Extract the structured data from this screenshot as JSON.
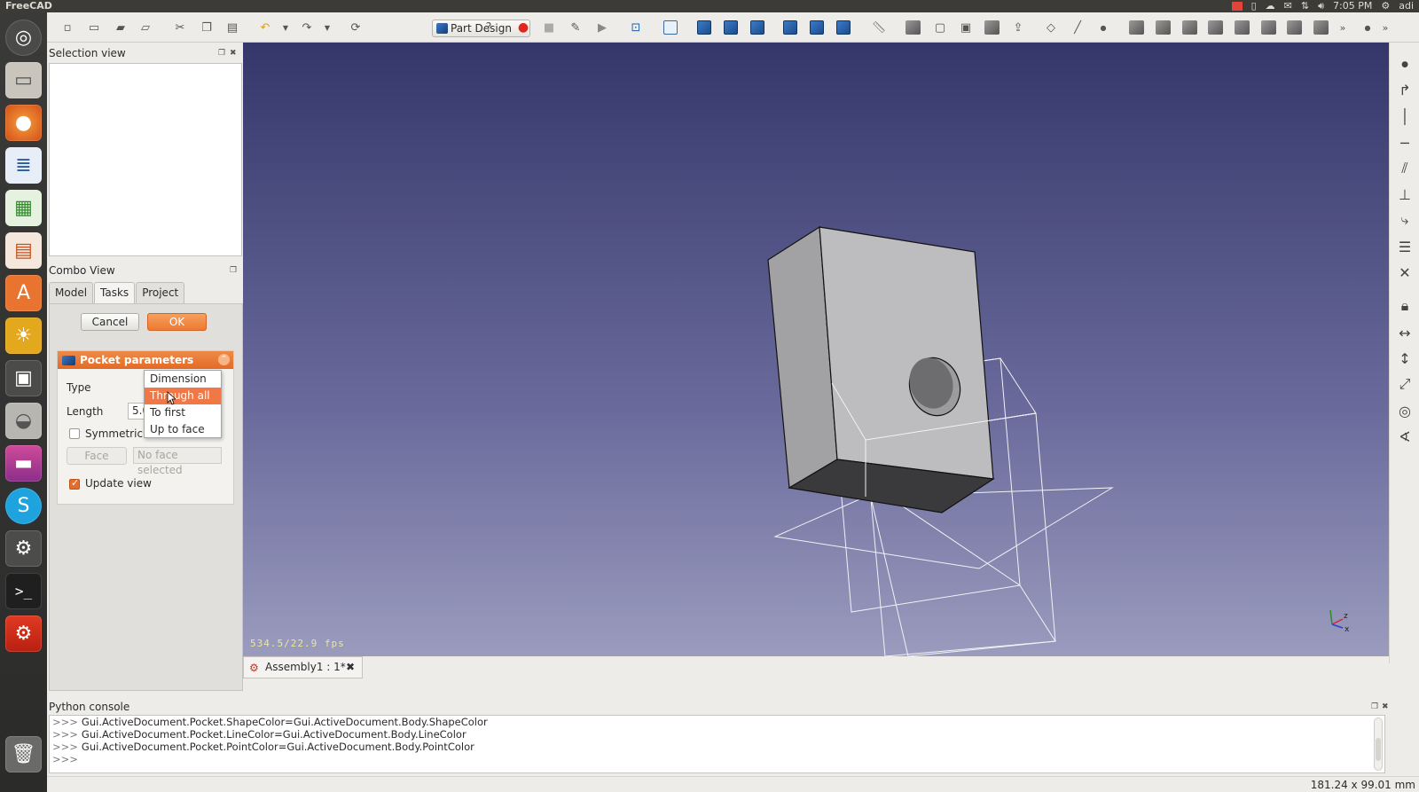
{
  "topbar": {
    "app_title": "FreeCAD",
    "time": "7:05 PM",
    "user": "adi"
  },
  "toolbar": {
    "workbench": "Part Design"
  },
  "selection_view": {
    "title": "Selection view"
  },
  "combo_view": {
    "title": "Combo View",
    "tabs": [
      {
        "label": "Model"
      },
      {
        "label": "Tasks"
      },
      {
        "label": "Project"
      }
    ],
    "cancel_label": "Cancel",
    "ok_label": "OK",
    "pocket": {
      "title": "Pocket parameters",
      "type_label": "Type",
      "length_label": "Length",
      "length_value": "5.0",
      "symmetric_label": "Symmetric to",
      "face_button": "Face",
      "face_value": "No face selected",
      "update_view_label": "Update view",
      "update_view_checked": true,
      "type_options": [
        "Dimension",
        "Through all",
        "To first",
        "Up to face"
      ],
      "type_selected_index": 1
    }
  },
  "viewport": {
    "fps": "534.5/22.9 fps",
    "doc_tab": "Assembly1 : 1*"
  },
  "python_console": {
    "title": "Python console",
    "prompt": ">>>",
    "lines": [
      "Gui.ActiveDocument.Pocket.ShapeColor=Gui.ActiveDocument.Body.ShapeColor",
      "Gui.ActiveDocument.Pocket.LineColor=Gui.ActiveDocument.Body.LineColor",
      "Gui.ActiveDocument.Pocket.PointColor=Gui.ActiveDocument.Body.PointColor",
      ""
    ]
  },
  "statusbar": {
    "dimensions": "181.24 x 99.01 mm"
  },
  "colors": {
    "accent": "#e8742f",
    "viewport_top": "#35366a",
    "viewport_bottom": "#9a9bbd"
  }
}
